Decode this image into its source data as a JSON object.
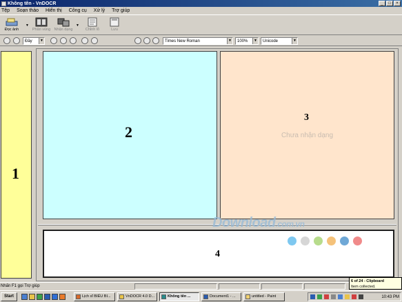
{
  "window": {
    "title": "Không tên - VnDOCR"
  },
  "menu": [
    "Tệp",
    "Soạn thảo",
    "Hiển thị",
    "Công cụ",
    "Xử lý",
    "Trợ giúp"
  ],
  "toolbar": {
    "read_image": "Đọc ảnh",
    "analyze": "Phân vùng",
    "recognize": "Nhận dạng",
    "edit": "Chỉnh lỗ",
    "save": "Lưu"
  },
  "toolbar2": {
    "fit_value": "Đầy",
    "font_value": "Times New Roman",
    "zoom_value": "100%",
    "encoding_value": "Unicode"
  },
  "panels": {
    "p1_number": "1",
    "p2_number": "2",
    "p3_number": "3",
    "p3_placeholder": "Chưa nhận dạng",
    "p4_number": "4"
  },
  "watermark": {
    "text": "Download",
    "suffix": ".com.vn"
  },
  "dot_colors": [
    "#7ec8f0",
    "#d6d6d6",
    "#b7dc8c",
    "#f5c27a",
    "#6fa8d6",
    "#f08a8a"
  ],
  "status": {
    "text": "Nhấn F1 gọi Trợ giúp"
  },
  "tooltip": {
    "line1": "6 of 24 - Clipboard",
    "line2": "Item collected."
  },
  "taskbar": {
    "start": "Start",
    "tasks": [
      "Lịch sĩ BIỂU BI...",
      "VnDOCR 4.0 D...",
      "Không tên ...",
      "Document1 - ...",
      "untitled - Paint"
    ],
    "clock": "10:43 PM"
  }
}
